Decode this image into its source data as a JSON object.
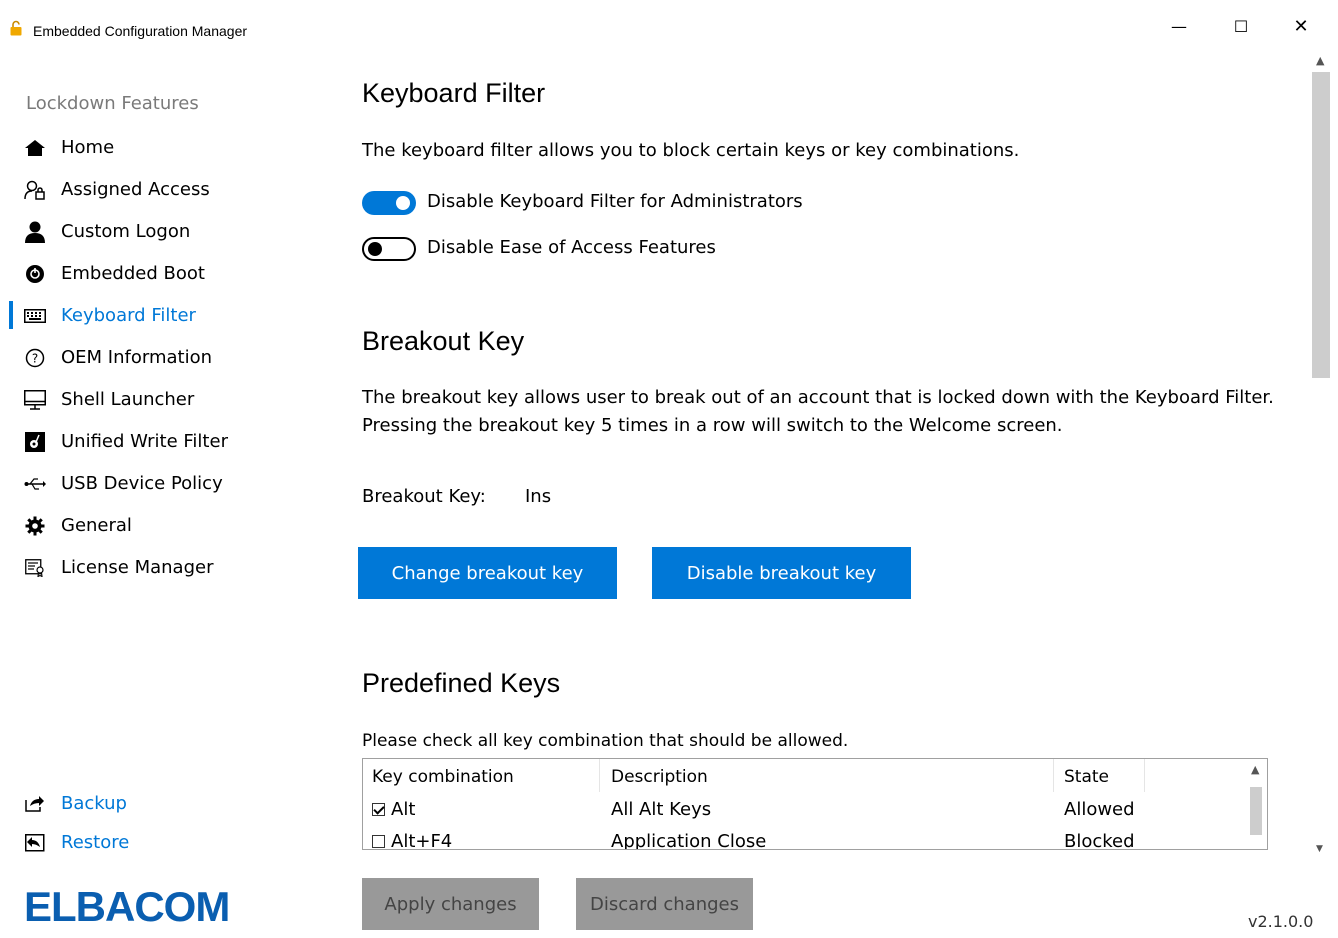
{
  "window": {
    "title": "Embedded Configuration Manager",
    "minimize": "—",
    "maximize": "☐",
    "close": "✕"
  },
  "sidebar": {
    "header": "Lockdown Features",
    "items": [
      {
        "label": "Home",
        "icon": "home-icon"
      },
      {
        "label": "Assigned Access",
        "icon": "user-lock-icon"
      },
      {
        "label": "Custom Logon",
        "icon": "person-icon"
      },
      {
        "label": "Embedded Boot",
        "icon": "power-icon"
      },
      {
        "label": "Keyboard Filter",
        "icon": "keyboard-icon",
        "active": true
      },
      {
        "label": "OEM Information",
        "icon": "help-icon"
      },
      {
        "label": "Shell Launcher",
        "icon": "monitor-icon"
      },
      {
        "label": "Unified Write Filter",
        "icon": "disk-icon"
      },
      {
        "label": "USB Device Policy",
        "icon": "usb-icon"
      },
      {
        "label": "General",
        "icon": "gear-icon"
      },
      {
        "label": "License Manager",
        "icon": "certificate-icon"
      }
    ],
    "backup": "Backup",
    "restore": "Restore",
    "logo": "ELBACOM"
  },
  "keyboard_filter": {
    "title": "Keyboard Filter",
    "description": "The keyboard filter allows you to block certain keys or key combinations.",
    "toggle_admin_label": "Disable Keyboard Filter for Administrators",
    "toggle_admin_on": true,
    "toggle_ease_label": "Disable Ease of Access Features",
    "toggle_ease_on": false
  },
  "breakout": {
    "title": "Breakout Key",
    "desc_line1": "The breakout key allows user to break out of an account that is locked down with the Keyboard Filter.",
    "desc_line2": "Pressing the breakout key 5 times in a row will switch to the Welcome screen.",
    "key_label": "Breakout Key:",
    "key_value": "Ins",
    "change_button": "Change breakout key",
    "disable_button": "Disable breakout key"
  },
  "predefined": {
    "title": "Predefined Keys",
    "instruction": "Please check all key combination that should be allowed.",
    "columns": [
      "Key combination",
      "Description",
      "State"
    ],
    "rows": [
      {
        "key": "Alt",
        "description": "All Alt Keys",
        "state": "Allowed",
        "checked": true
      },
      {
        "key": "Alt+F4",
        "description": "Application Close",
        "state": "Blocked",
        "checked": false
      }
    ]
  },
  "footer": {
    "apply": "Apply changes",
    "discard": "Discard changes",
    "version": "v2.1.0.0"
  },
  "colors": {
    "accent": "#0078d7",
    "logo": "#0a5eb0"
  }
}
